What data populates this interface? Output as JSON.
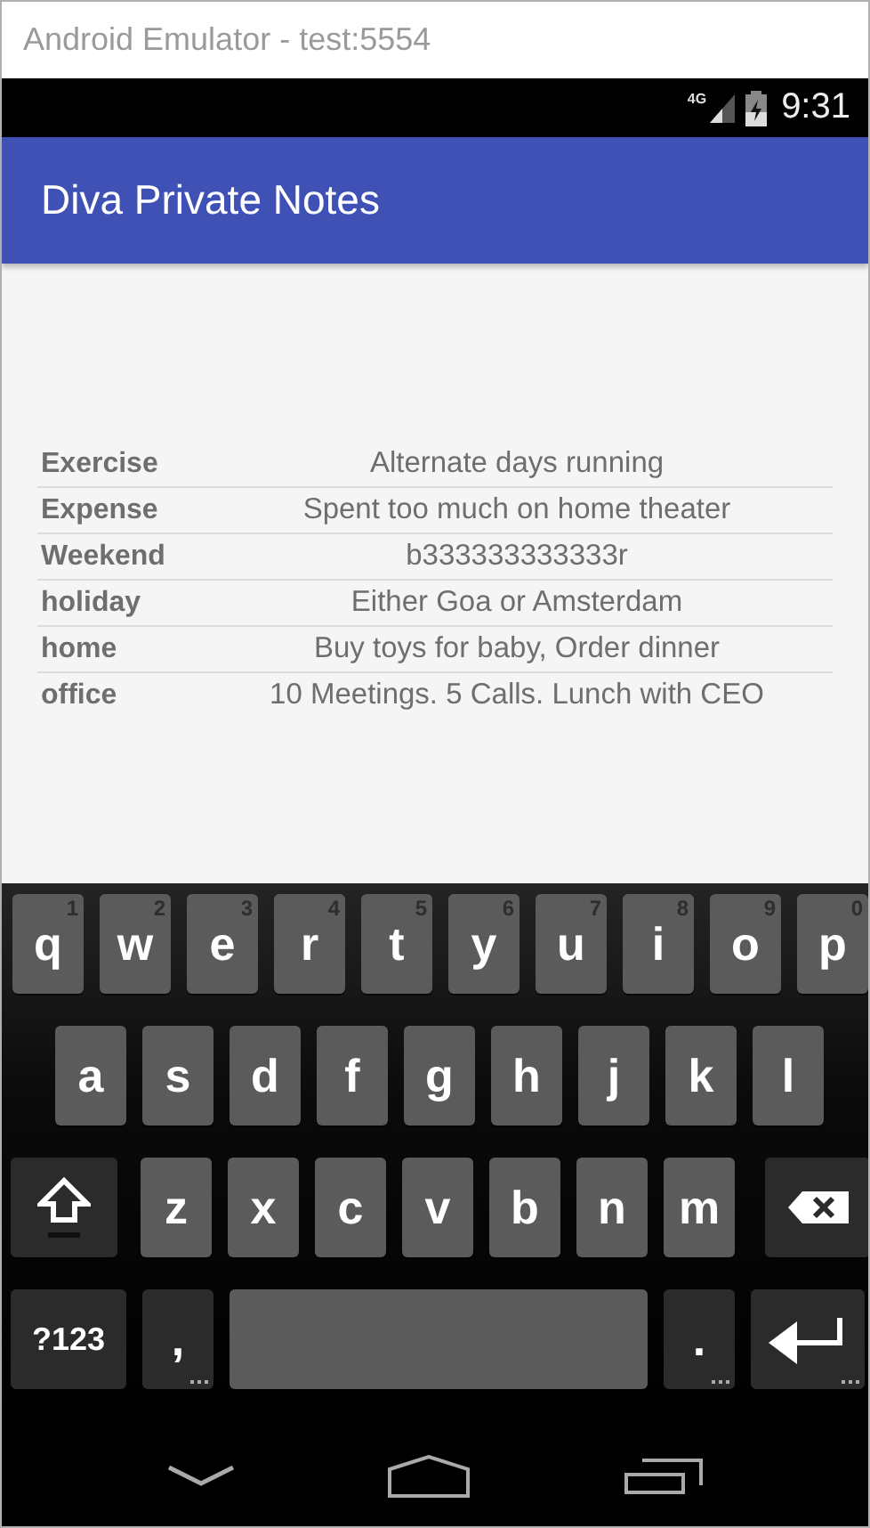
{
  "window": {
    "title": "Android Emulator - test:5554"
  },
  "status_bar": {
    "network": "4G",
    "time": "9:31"
  },
  "app_bar": {
    "title": "Diva Private Notes"
  },
  "notes": [
    {
      "title": "Exercise",
      "text": "Alternate days running"
    },
    {
      "title": "Expense",
      "text": "Spent too much on home theater"
    },
    {
      "title": "Weekend",
      "text": "b333333333333r"
    },
    {
      "title": "holiday",
      "text": "Either Goa or Amsterdam"
    },
    {
      "title": "home",
      "text": "Buy toys for baby, Order dinner"
    },
    {
      "title": "office",
      "text": "10 Meetings. 5 Calls. Lunch with CEO"
    }
  ],
  "keyboard": {
    "rows": [
      {
        "keys": [
          {
            "kind": "letter",
            "label": "q",
            "hint": "1"
          },
          {
            "kind": "letter",
            "label": "w",
            "hint": "2"
          },
          {
            "kind": "letter",
            "label": "e",
            "hint": "3"
          },
          {
            "kind": "letter",
            "label": "r",
            "hint": "4"
          },
          {
            "kind": "letter",
            "label": "t",
            "hint": "5"
          },
          {
            "kind": "letter",
            "label": "y",
            "hint": "6"
          },
          {
            "kind": "letter",
            "label": "u",
            "hint": "7"
          },
          {
            "kind": "letter",
            "label": "i",
            "hint": "8"
          },
          {
            "kind": "letter",
            "label": "o",
            "hint": "9"
          },
          {
            "kind": "letter",
            "label": "p",
            "hint": "0"
          }
        ]
      },
      {
        "keys": [
          {
            "kind": "letter",
            "label": "a"
          },
          {
            "kind": "letter",
            "label": "s"
          },
          {
            "kind": "letter",
            "label": "d"
          },
          {
            "kind": "letter",
            "label": "f"
          },
          {
            "kind": "letter",
            "label": "g"
          },
          {
            "kind": "letter",
            "label": "h"
          },
          {
            "kind": "letter",
            "label": "j"
          },
          {
            "kind": "letter",
            "label": "k"
          },
          {
            "kind": "letter",
            "label": "l"
          }
        ]
      },
      {
        "keys": [
          {
            "kind": "shift"
          },
          {
            "kind": "letter",
            "label": "z"
          },
          {
            "kind": "letter",
            "label": "x"
          },
          {
            "kind": "letter",
            "label": "c"
          },
          {
            "kind": "letter",
            "label": "v"
          },
          {
            "kind": "letter",
            "label": "b"
          },
          {
            "kind": "letter",
            "label": "n"
          },
          {
            "kind": "letter",
            "label": "m"
          },
          {
            "kind": "backspace"
          }
        ]
      },
      {
        "keys": [
          {
            "kind": "symbols",
            "label": "?123"
          },
          {
            "kind": "comma",
            "label": ","
          },
          {
            "kind": "space"
          },
          {
            "kind": "period",
            "label": "."
          },
          {
            "kind": "enter"
          }
        ]
      }
    ]
  }
}
